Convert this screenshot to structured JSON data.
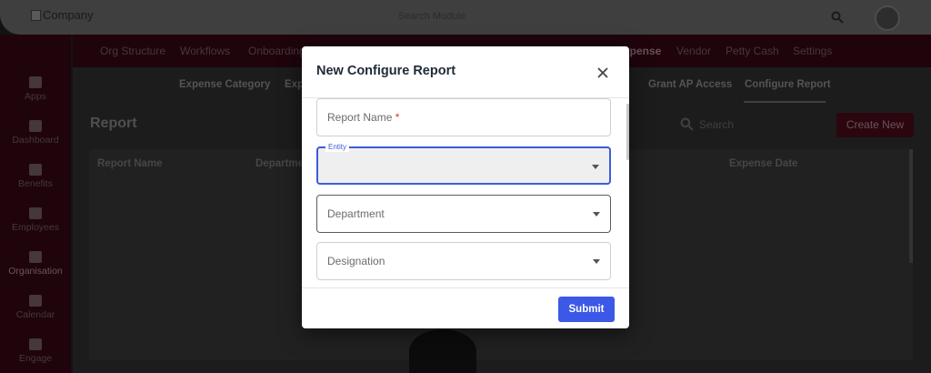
{
  "topbar": {
    "logo_alt": "Company",
    "search_placeholder": "Search Module"
  },
  "nav": {
    "items": [
      "Org Structure",
      "Workflows",
      "Onboarding",
      "Expense",
      "Vendor",
      "Petty Cash",
      "Settings"
    ]
  },
  "sidebar": {
    "items": [
      {
        "label": "Apps",
        "icon": "apps-icon"
      },
      {
        "label": "Dashboard",
        "icon": "dashboard-icon"
      },
      {
        "label": "Benefits",
        "icon": "benefits-icon"
      },
      {
        "label": "Employees",
        "icon": "employees-icon"
      },
      {
        "label": "Organisation",
        "icon": "organisation-icon"
      },
      {
        "label": "Calendar",
        "icon": "calendar-icon"
      },
      {
        "label": "Engage",
        "icon": "engage-icon"
      }
    ]
  },
  "subnav": {
    "items": [
      "Expense Category",
      "Expe",
      "Grant AP Access",
      "Configure Report"
    ]
  },
  "main": {
    "title": "Report",
    "search_placeholder": "Search",
    "create_label": "Create New",
    "table_headers": [
      "Report Name",
      "Departme",
      "Expense Date"
    ]
  },
  "modal": {
    "title": "New Configure Report",
    "fields": {
      "report_name": {
        "placeholder": "Report Name",
        "required_mark": "*"
      },
      "entity": {
        "label": "Entity",
        "value": ""
      },
      "department": {
        "placeholder": "Department"
      },
      "designation": {
        "placeholder": "Designation"
      }
    },
    "submit_label": "Submit"
  },
  "colors": {
    "brand": "#5a0a1e",
    "accent": "#3c58e7"
  }
}
